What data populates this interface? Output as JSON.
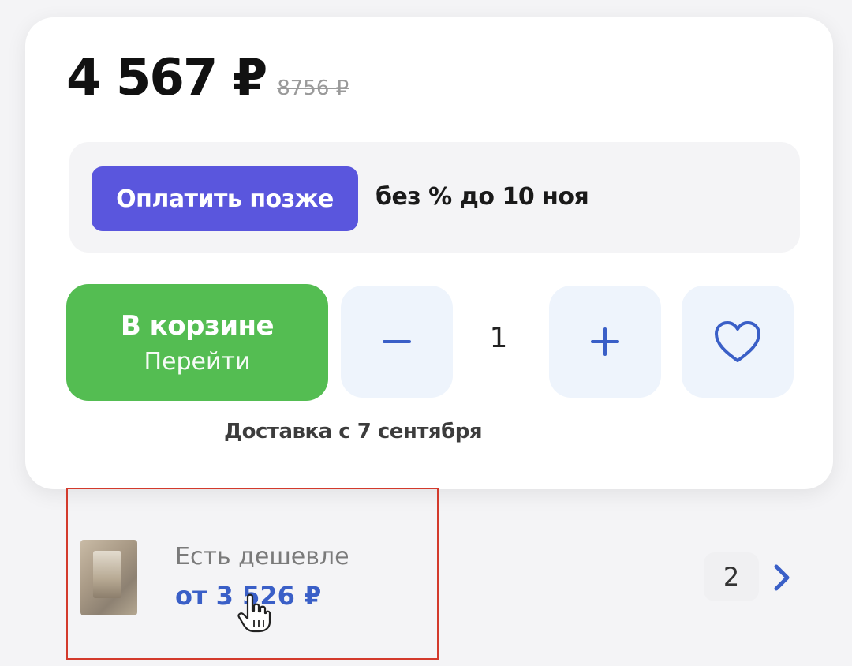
{
  "price": {
    "current": "4 567 ₽",
    "old": "8756 ₽"
  },
  "installment": {
    "pay_later_label": "Оплатить позже",
    "terms": "без % до 10 ноя"
  },
  "cart": {
    "title": "В корзине",
    "subtitle": "Перейти"
  },
  "quantity": {
    "value": "1",
    "decrement_icon": "minus-icon",
    "increment_icon": "plus-icon"
  },
  "favorite": {
    "icon": "heart-icon"
  },
  "delivery": {
    "text": "Доставка с 7 сентября"
  },
  "cheaper_offer": {
    "label": "Есть дешевле",
    "price": "от 3 526 ₽",
    "count": "2",
    "chevron_icon": "chevron-right-icon"
  },
  "colors": {
    "accent_purple": "#5a56dd",
    "cart_green": "#54bd52",
    "link_blue": "#3a5fc7",
    "highlight_red": "#d33a2c"
  }
}
